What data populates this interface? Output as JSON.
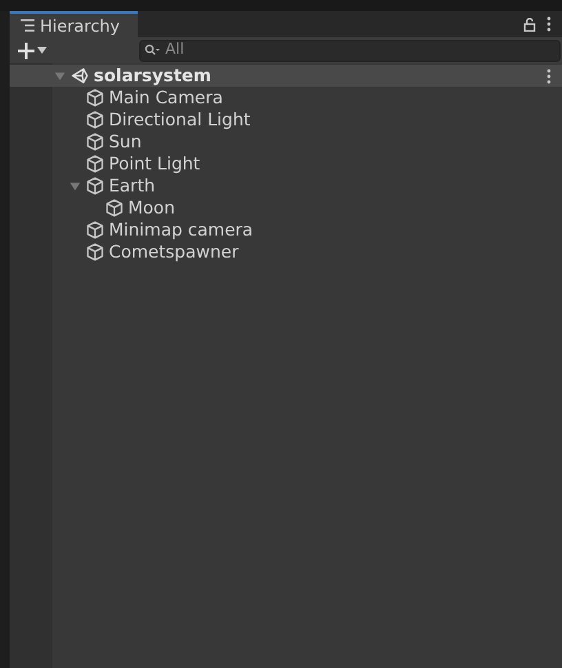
{
  "tab": {
    "title": "Hierarchy"
  },
  "search": {
    "placeholder": "All"
  },
  "scene": {
    "name": "solarsystem",
    "expanded": true,
    "children": [
      {
        "name": "Main Camera"
      },
      {
        "name": "Directional Light"
      },
      {
        "name": "Sun"
      },
      {
        "name": "Point Light"
      },
      {
        "name": "Earth",
        "expanded": true,
        "children": [
          {
            "name": "Moon"
          }
        ]
      },
      {
        "name": "Minimap camera"
      },
      {
        "name": "Cometspawner"
      }
    ]
  }
}
